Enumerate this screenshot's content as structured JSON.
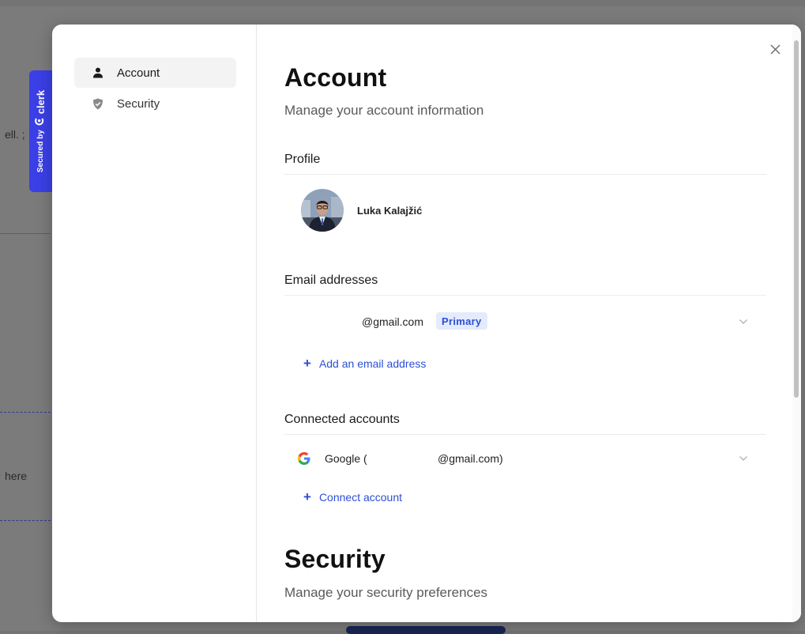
{
  "backdrop": {
    "text_top": "ell. ;",
    "text_middle": "here"
  },
  "clerk_badge": {
    "secured_by": "Secured by",
    "brand": "clerk"
  },
  "nav": {
    "items": [
      {
        "label": "Account",
        "icon": "user-icon",
        "active": true
      },
      {
        "label": "Security",
        "icon": "shield-icon",
        "active": false
      }
    ]
  },
  "close_icon": "close-icon",
  "account": {
    "title": "Account",
    "subtitle": "Manage your account information",
    "profile": {
      "section_title": "Profile",
      "name": "Luka Kalajžić"
    },
    "emails": {
      "section_title": "Email addresses",
      "items": [
        {
          "address": "@gmail.com",
          "badge": "Primary"
        }
      ],
      "add_label": "Add an email address"
    },
    "connected": {
      "section_title": "Connected accounts",
      "items": [
        {
          "provider": "Google (",
          "email": "@gmail.com)"
        }
      ],
      "add_label": "Connect account"
    }
  },
  "security": {
    "title": "Security",
    "subtitle": "Manage your security preferences"
  },
  "colors": {
    "accent": "#2d4fd6",
    "badge_bg": "#e4ebfd",
    "clerk_blue": "#3b3fe6"
  }
}
